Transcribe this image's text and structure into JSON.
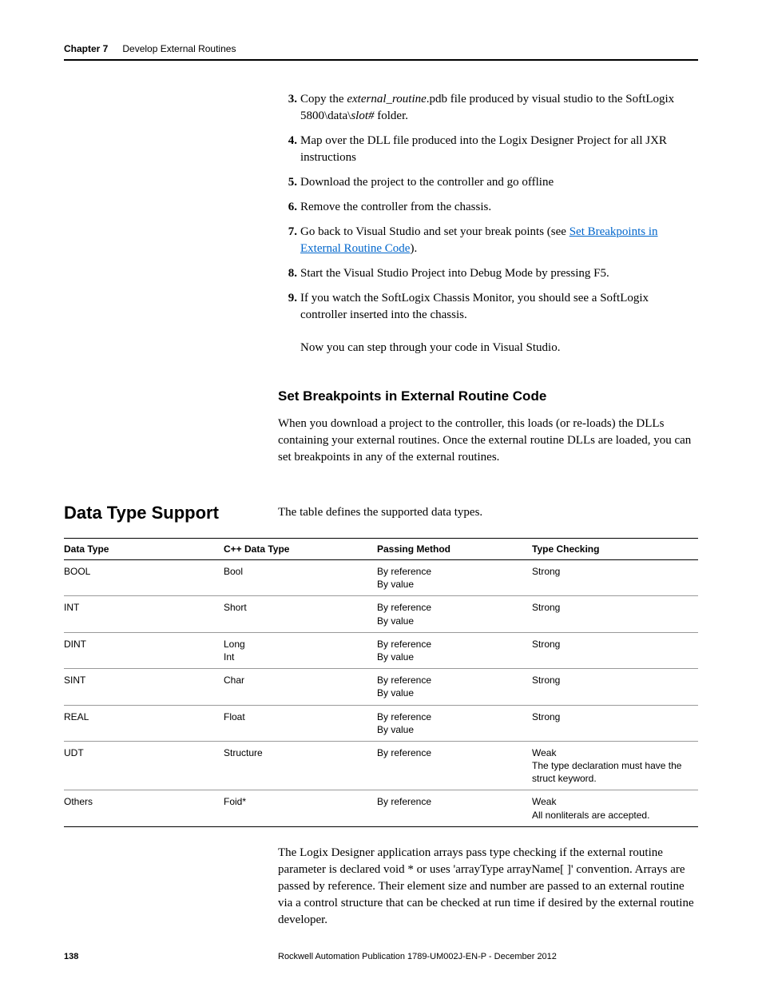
{
  "header": {
    "chapter": "Chapter 7",
    "title": "Develop External Routines"
  },
  "steps": [
    {
      "n": "3.",
      "pre": "Copy the ",
      "em": "external_routine",
      "mid": ".pdb file produced by visual studio to the SoftLogix 5800\\data\\",
      "em2": "slot#",
      "post": " folder."
    },
    {
      "n": "4.",
      "text": "Map over the DLL file produced into the Logix Designer Project for all JXR instructions"
    },
    {
      "n": "5.",
      "text": "Download the project to the controller and go offline"
    },
    {
      "n": "6.",
      "text": "Remove the controller from the chassis."
    },
    {
      "n": "7.",
      "pre": "Go back to Visual Studio and set your break points (see ",
      "link": "Set Breakpoints in External Routine Code",
      "post": ")."
    },
    {
      "n": "8.",
      "text": "Start the Visual Studio Project into Debug Mode by pressing F5."
    },
    {
      "n": "9.",
      "text": "If you watch the SoftLogix Chassis Monitor, you should see a SoftLogix controller inserted into the chassis."
    }
  ],
  "after_steps": "Now you can step through your code in Visual Studio.",
  "sub_heading": "Set Breakpoints in External Routine Code",
  "sub_body": "When you download a project to the controller, this loads (or re-loads) the DLLs containing your external routines. Once the external routine DLLs are loaded, you can set breakpoints in any of the external routines.",
  "section_heading": "Data Type Support",
  "section_lead": "The table defines the supported data types.",
  "table": {
    "headers": [
      "Data Type",
      "C++ Data Type",
      "Passing Method",
      "Type Checking"
    ],
    "rows": [
      {
        "c1": "BOOL",
        "c2": "Bool",
        "c3": "By reference\nBy value",
        "c4": "Strong"
      },
      {
        "c1": "INT",
        "c2": "Short",
        "c3": "By reference\nBy value",
        "c4": "Strong"
      },
      {
        "c1": "DINT",
        "c2": "Long\nInt",
        "c3": "By reference\nBy value",
        "c4": "Strong"
      },
      {
        "c1": "SINT",
        "c2": "Char",
        "c3": "By reference\nBy value",
        "c4": "Strong"
      },
      {
        "c1": "REAL",
        "c2": "Float",
        "c3": "By reference\nBy value",
        "c4": "Strong"
      },
      {
        "c1": "UDT",
        "c2": "Structure",
        "c3": "By reference",
        "c4": "Weak\nThe type declaration must have the struct keyword."
      },
      {
        "c1": "Others",
        "c2": "Foid*",
        "c3": "By reference",
        "c4": "Weak\nAll nonliterals are accepted."
      }
    ]
  },
  "after_table": "The Logix Designer application arrays pass type checking if the external routine parameter is declared void * or uses 'arrayType arrayName[ ]' convention. Arrays are passed by reference. Their element size and number are passed to an external routine via a control structure that can be checked at run time if desired by the external routine developer.",
  "footer": {
    "page": "138",
    "pub": "Rockwell Automation Publication 1789-UM002J-EN-P - December 2012"
  }
}
